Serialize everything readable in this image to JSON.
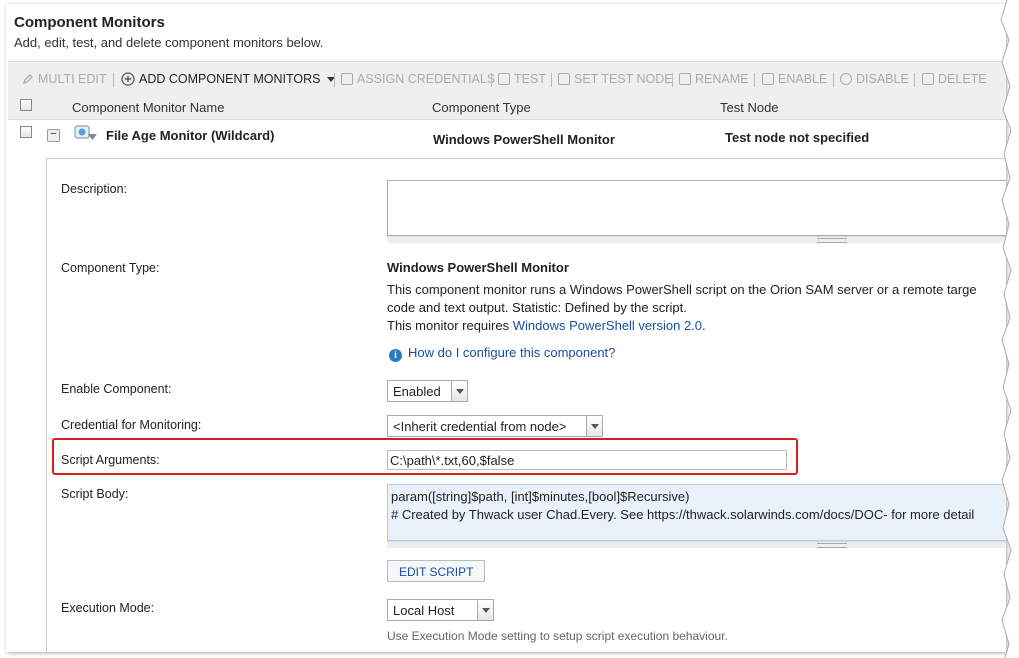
{
  "header": {
    "title": "Component Monitors",
    "subtitle": "Add, edit, test, and delete component monitors below."
  },
  "toolbar": {
    "items": [
      {
        "label": "MULTI EDIT",
        "icon": "pencil-icon",
        "enabled": false
      },
      {
        "label": "ADD COMPONENT MONITORS",
        "icon": "plus-circle-icon",
        "enabled": true
      },
      {
        "label": "ASSIGN CREDENTIALS",
        "icon": "credentials-icon",
        "enabled": false
      },
      {
        "label": "TEST",
        "icon": "test-icon",
        "enabled": false
      },
      {
        "label": "SET TEST NODE",
        "icon": "set-test-node-icon",
        "enabled": false
      },
      {
        "label": "RENAME",
        "icon": "rename-icon",
        "enabled": false
      },
      {
        "label": "ENABLE",
        "icon": "enable-icon",
        "enabled": false
      },
      {
        "label": "DISABLE",
        "icon": "disable-icon",
        "enabled": false
      },
      {
        "label": "DELETE",
        "icon": "trash-icon",
        "enabled": false
      }
    ]
  },
  "columns": {
    "name": "Component Monitor Name",
    "type": "Component Type",
    "node": "Test Node"
  },
  "monitor": {
    "name": "File Age Monitor (Wildcard)",
    "type": "Windows PowerShell Monitor",
    "node": "Test node not specified"
  },
  "detail": {
    "description_label": "Description:",
    "description_value": "",
    "component_type_label": "Component Type:",
    "component_type_title": "Windows PowerShell Monitor",
    "component_type_desc1": "This component monitor runs a Windows PowerShell script on the Orion SAM server or a remote targe",
    "component_type_desc2": "code and text output. Statistic: Defined by the script.",
    "requires_prefix": "This monitor requires ",
    "requires_link": "Windows PowerShell version 2.0",
    "requires_suffix": ".",
    "help_link": "How do I configure this component?",
    "enable_label": "Enable Component:",
    "enable_value": "Enabled",
    "credential_label": "Credential for Monitoring:",
    "credential_value": "<Inherit credential from node>",
    "script_args_label": "Script Arguments:",
    "script_args_value": "C:\\path\\*.txt,60,$false",
    "script_body_label": "Script Body:",
    "script_body_line1": "param([string]$path, [int]$minutes,[bool]$Recursive)",
    "script_body_line2": "# Created by Thwack user Chad.Every. See https://thwack.solarwinds.com/docs/DOC- for more detail",
    "edit_script_label": "EDIT SCRIPT",
    "exec_mode_label": "Execution Mode:",
    "exec_mode_value": "Local Host",
    "exec_mode_hint": "Use Execution Mode setting to setup script execution behaviour."
  },
  "colors": {
    "highlight": "#d62020",
    "link": "#1a4ea0",
    "script_bg": "#e9f2fb"
  }
}
